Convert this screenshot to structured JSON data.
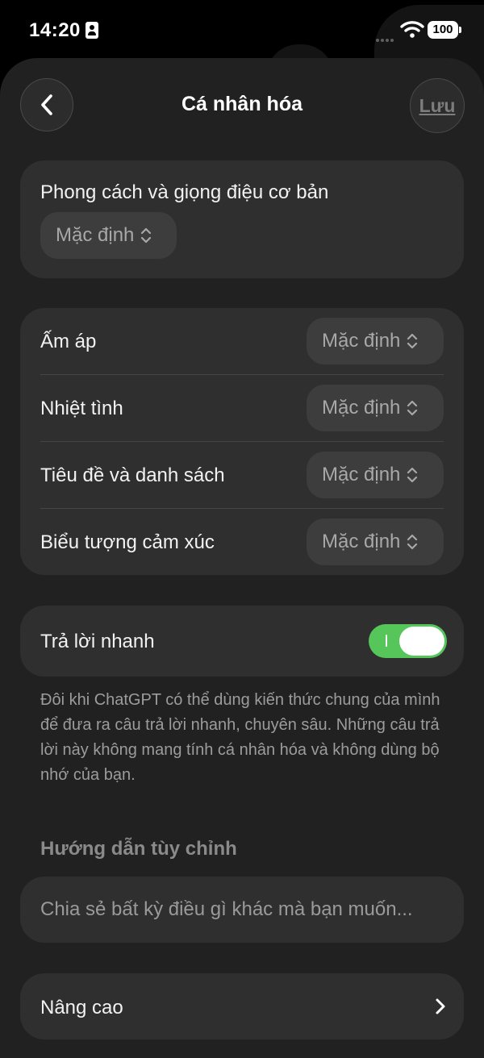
{
  "status_bar": {
    "time": "14:20",
    "battery": "100"
  },
  "header": {
    "title": "Cá nhân hóa",
    "save_label": "Lưu"
  },
  "base_style": {
    "title": "Phong cách và giọng điệu cơ bản",
    "value": "Mặc định"
  },
  "traits": [
    {
      "label": "Ấm áp",
      "value": "Mặc định"
    },
    {
      "label": "Nhiệt tình",
      "value": "Mặc định"
    },
    {
      "label": "Tiêu đề và danh sách",
      "value": "Mặc định"
    },
    {
      "label": "Biểu tượng cảm xúc",
      "value": "Mặc định"
    }
  ],
  "quick_answers": {
    "label": "Trả lời nhanh",
    "enabled": true,
    "description": "Đôi khi ChatGPT có thể dùng kiến thức chung của mình để đưa ra câu trả lời nhanh, chuyên sâu. Những câu trả lời này không mang tính cá nhân hóa và không dùng bộ nhớ của bạn."
  },
  "custom_instructions": {
    "heading": "Hướng dẫn tùy chỉnh",
    "placeholder": "Chia sẻ bất kỳ điều gì khác mà bạn muốn...",
    "value": ""
  },
  "advanced": {
    "label": "Nâng cao"
  },
  "colors": {
    "background": "#212121",
    "card": "#2f2f2f",
    "pill": "#3d3d3d",
    "toggle_on": "#56c65a"
  }
}
